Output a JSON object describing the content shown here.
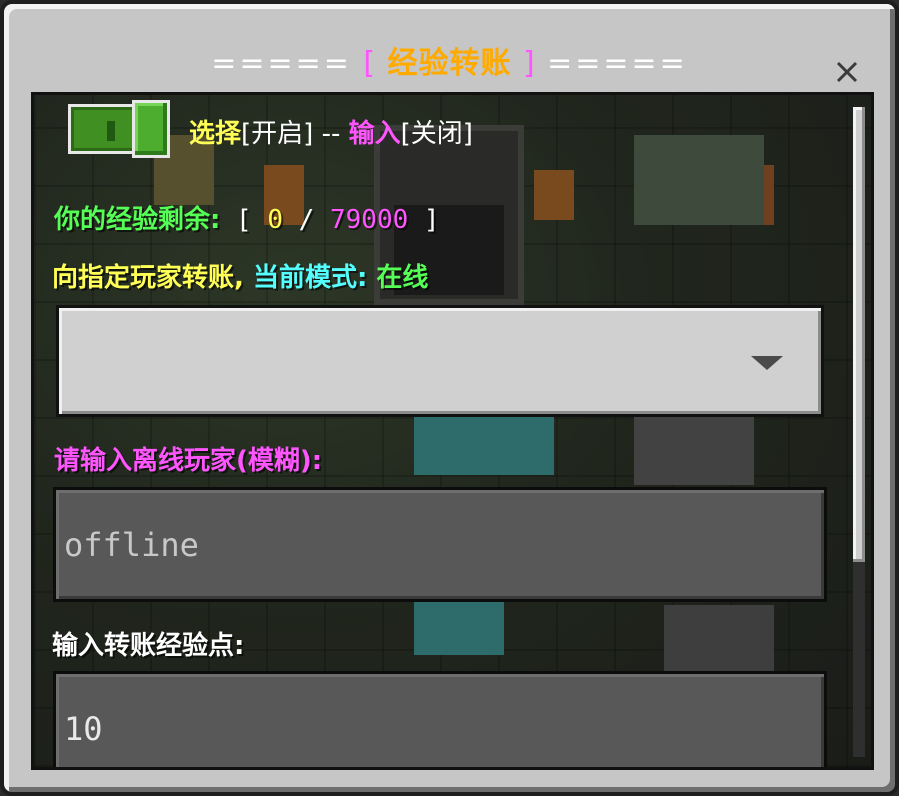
{
  "title": {
    "left_dashes": "=====",
    "open_bracket": "[",
    "text": "经验转账",
    "close_bracket": "]",
    "right_dashes": "====="
  },
  "close_icon": "close-icon",
  "toggle": {
    "state": "on",
    "label_select": "选择",
    "label_open": "[开启]",
    "label_sep": " -- ",
    "label_input": "输入",
    "label_close": "[关闭]"
  },
  "exp": {
    "label": "你的经验剩余:",
    "open": " [ ",
    "current": "0",
    "slash": " / ",
    "max": "79000",
    "close": " ]"
  },
  "transfer": {
    "label": "向指定玩家转账,",
    "mode_label": " 当前模式:",
    "mode_value": " 在线"
  },
  "dropdown": {
    "selected": "",
    "arrow_icon": "chevron-down-icon"
  },
  "offline": {
    "label": "请输入离线玩家(模糊):",
    "placeholder": "offline",
    "value": ""
  },
  "points": {
    "label": "输入转账经验点:",
    "value": "10"
  },
  "colors": {
    "title_accent": "#ffaa00",
    "bracket": "#ff55ff",
    "yellow": "#ffff55",
    "green": "#55ff55",
    "aqua": "#55ffff",
    "toggle_on": "#4cad2e"
  }
}
